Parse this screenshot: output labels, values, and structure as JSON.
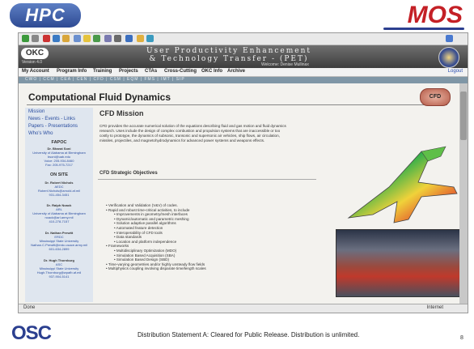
{
  "slide": {
    "hpc_logo": "HPC",
    "mos_logo": "MOS",
    "osc_logo": "OSC",
    "distribution": "Distribution Statement A: Cleared for Public Release. Distribution is unlimited.",
    "page_number": "8"
  },
  "site": {
    "logo": "OKC",
    "version": "Version 4.0",
    "title_line1": "User Productivity Enhancement",
    "title_line2": "& Technology Transfer - (PET)",
    "welcome": "Welcome: Denise Mullinax",
    "nav": [
      "My Account",
      "Program Info",
      "Training",
      "Projects",
      "CTAs",
      "Cross-Cutting",
      "OKC Info",
      "Archive"
    ],
    "logout": "Logout",
    "subnav": "CWO | CCM | CEA | CEN | CFD | CSM | EQM | FMS | IMT | SIP"
  },
  "page": {
    "title": "Computational Fluid Dynamics",
    "badge": "CFD",
    "sidebar": {
      "links": [
        "Mission",
        "News - Events - Links",
        "Papers - Presentations",
        "Who's Who"
      ],
      "fapoc_header": "FAPOC",
      "onsite_header": "ON SITE",
      "contacts": [
        {
          "name": "Dr. Bharat Soni",
          "lines": [
            "University of Alabama at Birmingham",
            "bsoni@uab.edu",
            "Voice: 205-934-8460",
            "Fax: 205-975-7217"
          ]
        },
        {
          "name": "Dr. Robert Nichols",
          "lines": [
            "AEDC",
            "Robert.Nichols@arnold.af.mil",
            "931-454-3451"
          ]
        },
        {
          "name": "Dr. Ralph Noack",
          "lines": [
            "ARL",
            "University of Alabama at Birmingham",
            "noack@arl.army.mil",
            "410-278-7157"
          ]
        },
        {
          "name": "Dr. Nathan Prewitt",
          "lines": [
            "ERDC",
            "Mississippi State University",
            "Nathan.C.Prewitt@erdc.usace.army.mil",
            "601-634-2899"
          ]
        },
        {
          "name": "Dr. Hugh Thornburg",
          "lines": [
            "ASC",
            "Mississippi State University",
            "Hugh.Thornburg@wpafb.af.mil",
            "937-904-5141"
          ]
        }
      ]
    },
    "mission_heading": "CFD Mission",
    "mission_text": "CFD provides the accurate numerical solution of the equations describing fluid and gas motion and fluid dynamics research. Uses include the design of complex combustion and propulsion systems that are inaccessible or too costly to prototype, the dynamics of subsonic, transonic and supersonic air vehicles, ship flows, air circulation, missiles, projectiles, and magnetohydrodynamics for advanced power systems and weapons effects.",
    "objectives_heading": "CFD Strategic Objectives",
    "objectives": [
      {
        "level": 1,
        "text": "Verification and Validation (V&V) of codes."
      },
      {
        "level": 1,
        "text": "Rapid and robust time-critical activities, to include"
      },
      {
        "level": 2,
        "text": "Improvements in geometry/mesh interfaces"
      },
      {
        "level": 2,
        "text": "Dynamic/automatic and parametric meshing"
      },
      {
        "level": 2,
        "text": "Solution adaptive parallel algorithms"
      },
      {
        "level": 2,
        "text": "Automated feature detection"
      },
      {
        "level": 2,
        "text": "Interoperability of CFD tools"
      },
      {
        "level": 2,
        "text": "Data standards"
      },
      {
        "level": 2,
        "text": "Location and platform independence"
      },
      {
        "level": 1,
        "text": "Frameworks"
      },
      {
        "level": 2,
        "text": "Multidisciplinary Optimization (MDO)"
      },
      {
        "level": 2,
        "text": "Simulation Based Acquisition (SBA)"
      },
      {
        "level": 2,
        "text": "Simulation Based Design (SBD)"
      },
      {
        "level": 1,
        "text": "Time-varying geometries and/or highly unsteady flow fields"
      },
      {
        "level": 1,
        "text": "Multiphysics coupling involving disparate time/length scales"
      }
    ]
  },
  "browser": {
    "status": "Done",
    "zone": "Internet"
  }
}
